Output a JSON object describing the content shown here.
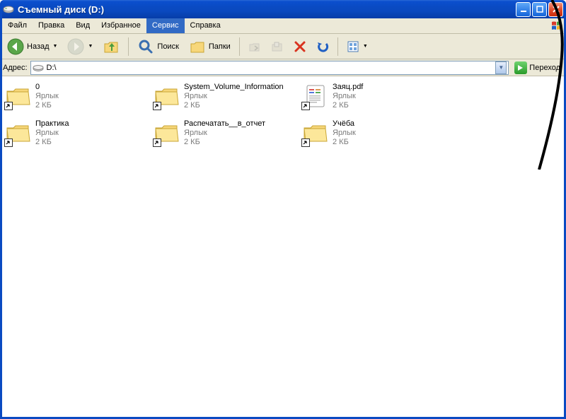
{
  "window": {
    "title": "Съемный диск (D:)"
  },
  "menu": {
    "file": "Файл",
    "edit": "Правка",
    "view": "Вид",
    "favorites": "Избранное",
    "tools": "Сервис",
    "help": "Справка"
  },
  "toolbar": {
    "back_label": "Назад",
    "search_label": "Поиск",
    "folders_label": "Папки"
  },
  "addressbar": {
    "label": "Адрес:",
    "path": "D:\\",
    "go_label": "Переход"
  },
  "files": {
    "type_label": "Ярлык",
    "size_label": "2 КБ",
    "items": [
      {
        "name": "0",
        "type": "folder-shortcut"
      },
      {
        "name": "System_Volume_Information",
        "type": "folder-shortcut"
      },
      {
        "name": "Заяц.pdf",
        "type": "file-shortcut"
      },
      {
        "name": "Практика",
        "type": "folder-shortcut"
      },
      {
        "name": "Распечатать__в_отчет",
        "type": "folder-shortcut"
      },
      {
        "name": "Учёба",
        "type": "folder-shortcut"
      }
    ]
  }
}
